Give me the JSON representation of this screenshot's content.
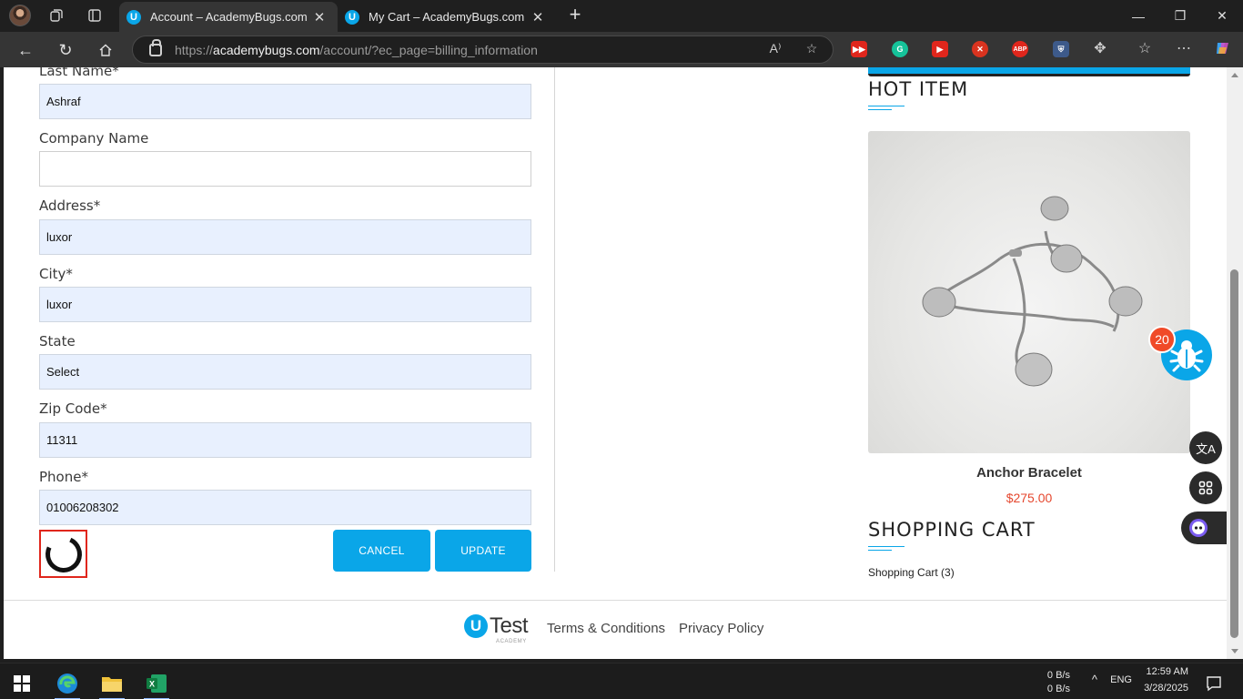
{
  "browser": {
    "tabs": [
      {
        "title": "Account – AcademyBugs.com",
        "favicon": "U",
        "active": true
      },
      {
        "title": "My Cart – AcademyBugs.com",
        "favicon": "U",
        "active": false
      }
    ],
    "url_prefix": "https://",
    "url_domain": "academybugs.com",
    "url_path": "/account/?ec_page=billing_information",
    "extensions": [
      "media-ext",
      "grammarly-ext",
      "video-ext",
      "red-ext",
      "adblock-plus-ext",
      "shield-ext"
    ],
    "adblock_label": "ABP"
  },
  "form": {
    "last_name_label": "Last Name*",
    "last_name_value": "Ashraf",
    "company_label": "Company Name",
    "company_value": "",
    "address_label": "Address*",
    "address_value": "luxor",
    "city_label": "City*",
    "city_value": "luxor",
    "state_label": "State",
    "state_value": "Select",
    "zip_label": "Zip Code*",
    "zip_value": "11311",
    "phone_label": "Phone*",
    "phone_value": "01006208302",
    "cancel_label": "CANCEL",
    "update_label": "UPDATE"
  },
  "sidebar": {
    "hot_item_title": "HOT ITEM",
    "product_name": "Anchor Bracelet",
    "product_price": "$275.00",
    "cart_title": "SHOPPING CART",
    "cart_link": "Shopping Cart (3)"
  },
  "widgets": {
    "bug_count": "20"
  },
  "footer": {
    "logo_u": "U",
    "logo_text": "Test",
    "logo_sub": "ACADEMY",
    "terms": "Terms & Conditions",
    "privacy": "Privacy Policy"
  },
  "taskbar": {
    "net_up": "0 B/s",
    "net_down": "0 B/s",
    "language": "ENG",
    "time": "12:59 AM",
    "date": "3/28/2025"
  },
  "colors": {
    "accent": "#0aa6e8",
    "price": "#e5472e",
    "badge": "#f04a28",
    "highlight_border": "#e0261c"
  }
}
